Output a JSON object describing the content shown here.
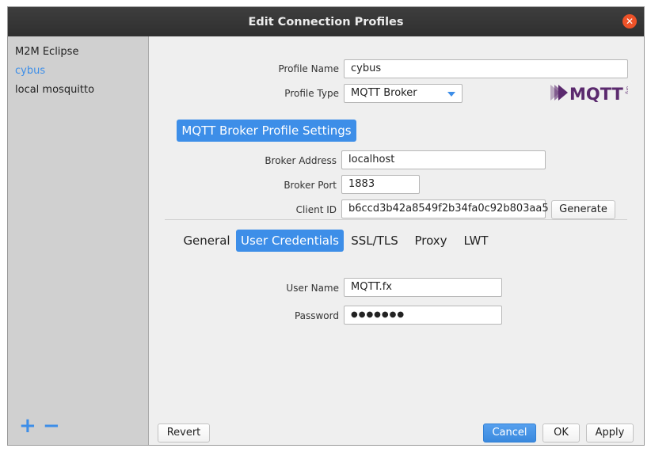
{
  "window": {
    "title": "Edit Connection Profiles"
  },
  "sidebar": {
    "items": [
      {
        "label": "M2M Eclipse",
        "selected": false
      },
      {
        "label": "cybus",
        "selected": true
      },
      {
        "label": "local mosquitto",
        "selected": false
      }
    ],
    "add_icon": "plus-icon",
    "remove_icon": "minus-icon"
  },
  "profile": {
    "name_label": "Profile Name",
    "name_value": "cybus",
    "type_label": "Profile Type",
    "type_value": "MQTT Broker"
  },
  "logo": {
    "text": "MQTT",
    "small_text": "org"
  },
  "broker": {
    "section_title": "MQTT Broker Profile Settings",
    "address_label": "Broker Address",
    "address_value": "localhost",
    "port_label": "Broker Port",
    "port_value": "1883",
    "client_id_label": "Client ID",
    "client_id_value": "b6ccd3b42a8549f2b34fa0c92b803aa5",
    "generate_label": "Generate"
  },
  "tabs": [
    {
      "label": "General",
      "active": false
    },
    {
      "label": "User Credentials",
      "active": true
    },
    {
      "label": "SSL/TLS",
      "active": false
    },
    {
      "label": "Proxy",
      "active": false
    },
    {
      "label": "LWT",
      "active": false
    }
  ],
  "credentials": {
    "username_label": "User Name",
    "username_value": "MQTT.fx",
    "password_label": "Password",
    "password_value": "●●●●●●●"
  },
  "footer": {
    "revert_label": "Revert",
    "cancel_label": "Cancel",
    "ok_label": "OK",
    "apply_label": "Apply"
  },
  "colors": {
    "accent": "#3d8ee8",
    "titlebar": "#333333",
    "close": "#ee5228",
    "logo": "#5b2a6e"
  }
}
